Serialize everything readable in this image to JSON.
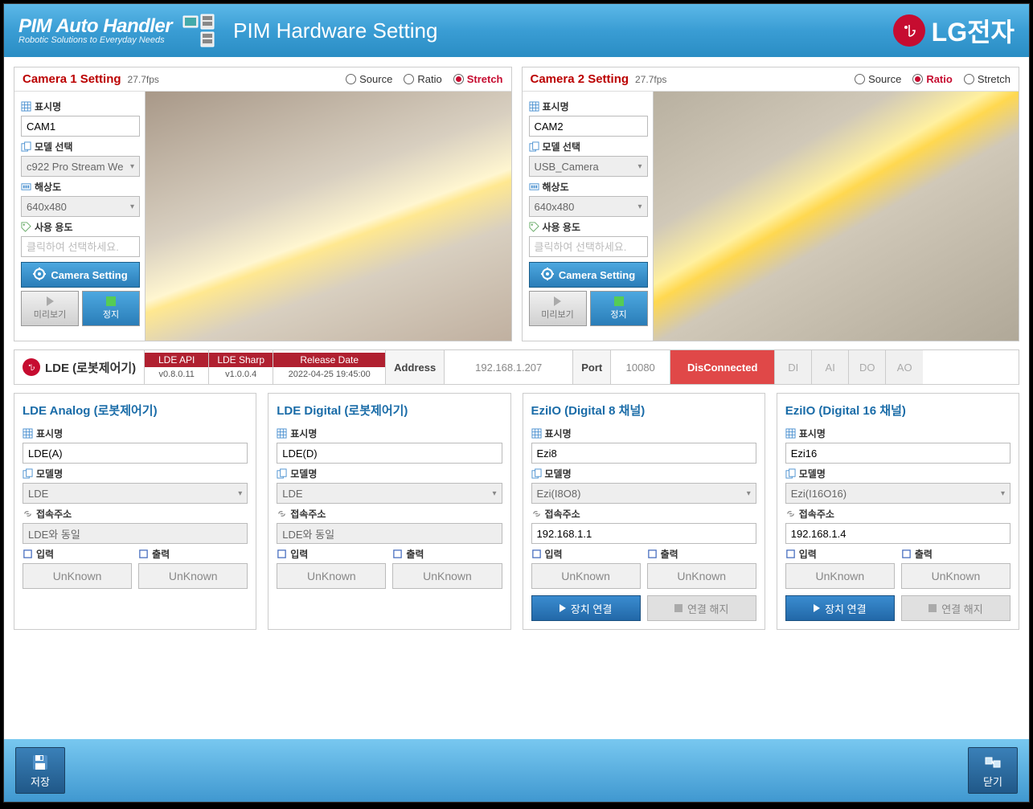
{
  "header": {
    "app_title": "PIM Auto Handler",
    "app_subtitle": "Robotic Solutions to Everyday Needs",
    "page_title": "PIM Hardware Setting",
    "brand": "LG전자"
  },
  "cameras": [
    {
      "title": "Camera 1 Setting",
      "fps": "27.7fps",
      "view_mode": "Stretch",
      "labels": {
        "display": "표시명",
        "model": "모델 선택",
        "resolution": "해상도",
        "usage": "사용 용도"
      },
      "display_name": "CAM1",
      "model": "c922 Pro Stream We",
      "resolution": "640x480",
      "usage_placeholder": "클릭하여 선택하세요.",
      "setting_btn": "Camera Setting",
      "preview": "미리보기",
      "stop": "정지"
    },
    {
      "title": "Camera 2 Setting",
      "fps": "27.7fps",
      "view_mode": "Ratio",
      "labels": {
        "display": "표시명",
        "model": "모델 선택",
        "resolution": "해상도",
        "usage": "사용 용도"
      },
      "display_name": "CAM2",
      "model": "USB_Camera",
      "resolution": "640x480",
      "usage_placeholder": "클릭하여 선택하세요.",
      "setting_btn": "Camera Setting",
      "preview": "미리보기",
      "stop": "정지"
    }
  ],
  "view_opts": {
    "source": "Source",
    "ratio": "Ratio",
    "stretch": "Stretch"
  },
  "lde_bar": {
    "name": "LDE (로봇제어기)",
    "api_head": "LDE API",
    "api_ver": "v0.8.0.11",
    "sharp_head": "LDE Sharp",
    "sharp_ver": "v1.0.0.4",
    "rel_head": "Release Date",
    "rel_val": "2022-04-25 19:45:00",
    "addr_label": "Address",
    "addr_val": "192.168.1.207",
    "port_label": "Port",
    "port_val": "10080",
    "status": "DisConnected",
    "di": "DI",
    "ai": "AI",
    "do": "DO",
    "ao": "AO"
  },
  "dev_labels": {
    "display": "표시명",
    "model": "모델명",
    "addr": "접속주소",
    "input": "입력",
    "output": "출력",
    "unknown": "UnKnown",
    "connect": "장치 연결",
    "disconnect": "연결 해지"
  },
  "devices": [
    {
      "title": "LDE Analog (로봇제어기)",
      "display_name": "LDE(A)",
      "model": "LDE",
      "addr": "LDE와 동일",
      "addr_disabled": true,
      "has_conn": false
    },
    {
      "title": "LDE Digital (로봇제어기)",
      "display_name": "LDE(D)",
      "model": "LDE",
      "addr": "LDE와 동일",
      "addr_disabled": true,
      "has_conn": false
    },
    {
      "title": "EziIO (Digital 8 채널)",
      "display_name": "Ezi8",
      "model": "Ezi(I8O8)",
      "addr": "192.168.1.1",
      "addr_disabled": false,
      "has_conn": true
    },
    {
      "title": "EziIO (Digital 16 채널)",
      "display_name": "Ezi16",
      "model": "Ezi(I16O16)",
      "addr": "192.168.1.4",
      "addr_disabled": false,
      "has_conn": true
    }
  ],
  "footer": {
    "save": "저장",
    "close": "닫기"
  }
}
